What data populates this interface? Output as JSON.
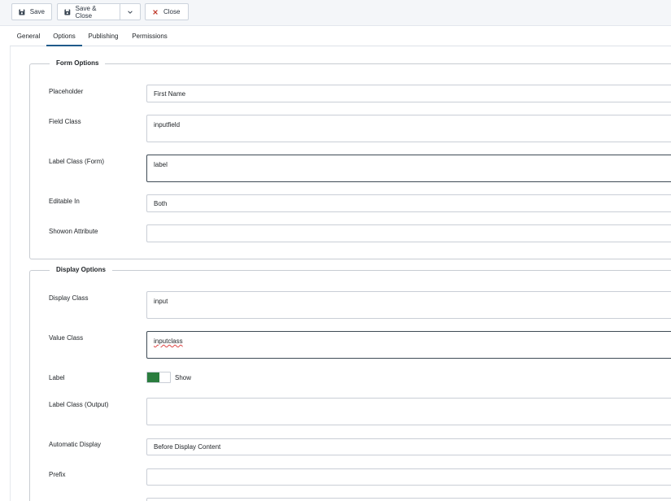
{
  "toolbar": {
    "save_label": "Save",
    "save_close_label": "Save & Close",
    "close_label": "Close"
  },
  "tabs": [
    {
      "label": "General"
    },
    {
      "label": "Options"
    },
    {
      "label": "Publishing"
    },
    {
      "label": "Permissions"
    }
  ],
  "active_tab": "Options",
  "form_options": {
    "legend": "Form Options",
    "placeholder": {
      "label": "Placeholder",
      "value": "First Name"
    },
    "field_class": {
      "label": "Field Class",
      "value": "inputfield"
    },
    "label_class_form": {
      "label": "Label Class (Form)",
      "value": "label"
    },
    "editable_in": {
      "label": "Editable In",
      "value": "Both"
    },
    "showon_attribute": {
      "label": "Showon Attribute",
      "value": ""
    }
  },
  "display_options": {
    "legend": "Display Options",
    "display_class": {
      "label": "Display Class",
      "value": "input"
    },
    "value_class": {
      "label": "Value Class",
      "value": "inputclass"
    },
    "label": {
      "label": "Label",
      "toggle_text": "Show",
      "on": true
    },
    "label_class_output": {
      "label": "Label Class (Output)",
      "value": ""
    },
    "automatic_display": {
      "label": "Automatic Display",
      "value": "Before Display Content"
    },
    "prefix": {
      "label": "Prefix",
      "value": ""
    }
  },
  "colors": {
    "toggle_on": "#2a7d3e",
    "close_icon": "#c0392b",
    "active_tab_underline": "#1f5a8a"
  }
}
